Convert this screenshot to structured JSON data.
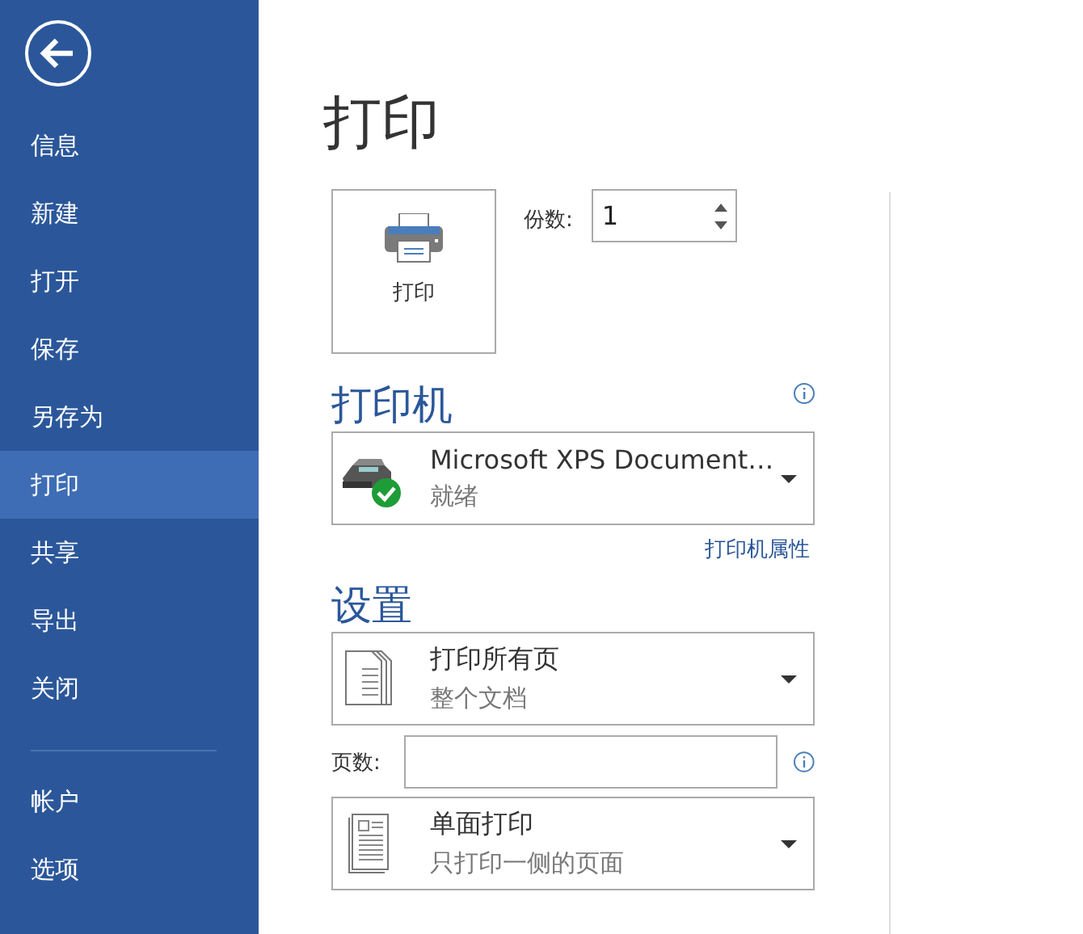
{
  "sidebar": {
    "items": [
      {
        "label": "信息",
        "selected": false
      },
      {
        "label": "新建",
        "selected": false
      },
      {
        "label": "打开",
        "selected": false
      },
      {
        "label": "保存",
        "selected": false
      },
      {
        "label": "另存为",
        "selected": false
      },
      {
        "label": "打印",
        "selected": true
      },
      {
        "label": "共享",
        "selected": false
      },
      {
        "label": "导出",
        "selected": false
      },
      {
        "label": "关闭",
        "selected": false
      }
    ],
    "footer_items": [
      {
        "label": "帐户",
        "selected": false
      },
      {
        "label": "选项",
        "selected": false
      }
    ]
  },
  "title": "打印",
  "print_button": {
    "label": "打印"
  },
  "copies": {
    "label": "份数:",
    "value": "1"
  },
  "printer": {
    "heading": "打印机",
    "name": "Microsoft XPS Document…",
    "status": "就绪",
    "properties_link": "打印机属性"
  },
  "settings": {
    "heading": "设置",
    "rows": [
      {
        "kind": "stack",
        "title": "打印所有页",
        "subtitle": "整个文档"
      },
      {
        "kind": "field",
        "label": "页数:"
      },
      {
        "kind": "single",
        "title": "单面打印",
        "subtitle": "只打印一侧的页面"
      }
    ]
  }
}
